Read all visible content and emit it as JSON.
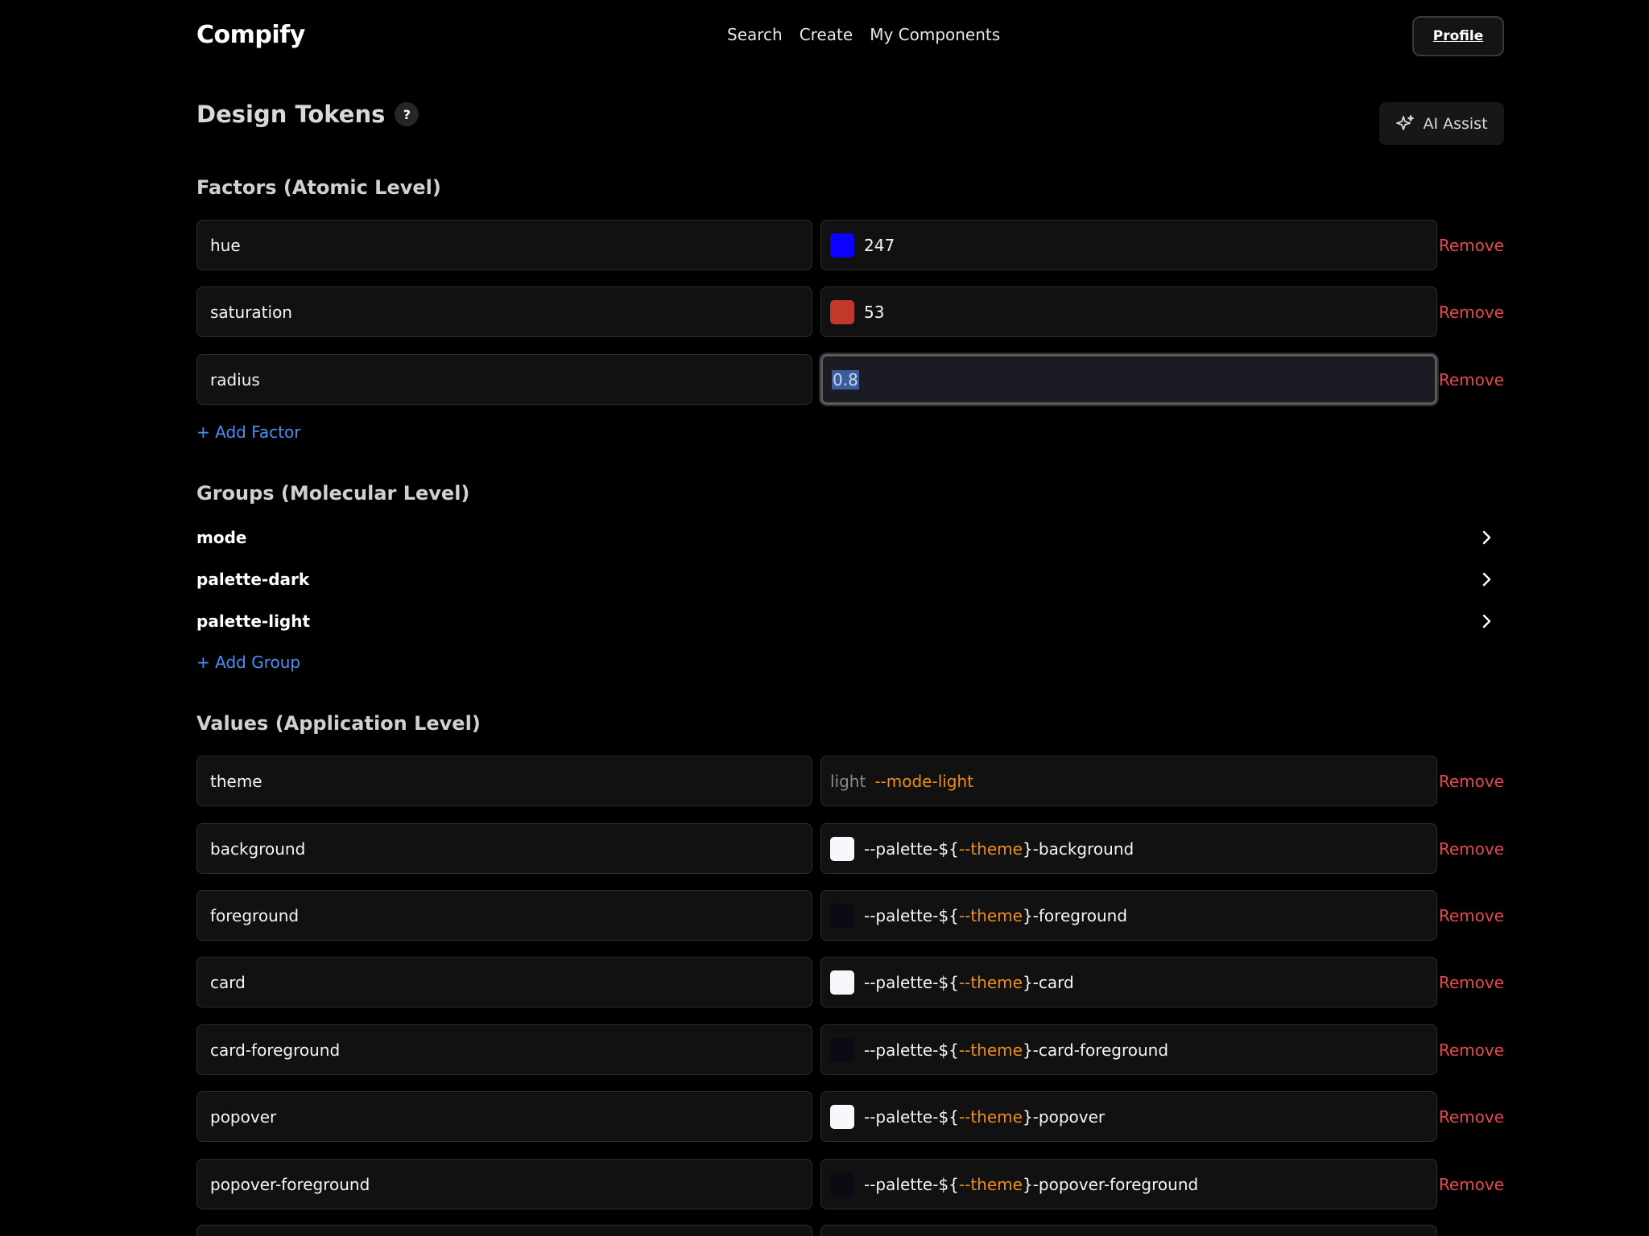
{
  "header": {
    "logo": "Compify",
    "nav": [
      "Search",
      "Create",
      "My Components"
    ],
    "profile_label": "Profile"
  },
  "page": {
    "title": "Design Tokens",
    "help": "?",
    "ai_assist_label": "AI Assist"
  },
  "factors": {
    "title": "Factors (Atomic Level)",
    "add_label": "+ Add Factor",
    "remove_label": "Remove",
    "items": [
      {
        "name": "hue",
        "value": "247",
        "swatch": "#0c00ff"
      },
      {
        "name": "saturation",
        "value": "53",
        "swatch": "#c0392b"
      },
      {
        "name": "radius",
        "value": "0.8"
      }
    ]
  },
  "groups": {
    "title": "Groups (Molecular Level)",
    "add_label": "+ Add Group",
    "items": [
      "mode",
      "palette-dark",
      "palette-light"
    ]
  },
  "values": {
    "title": "Values (Application Level)",
    "remove_label": "Remove",
    "theme": {
      "name": "theme",
      "prefix": "light",
      "ref": "--mode-light"
    },
    "items": [
      {
        "name": "background",
        "pre": "--palette-${",
        "var": "--theme",
        "post": "}-background",
        "swatch": "#f8f8fc"
      },
      {
        "name": "foreground",
        "pre": "--palette-${",
        "var": "--theme",
        "post": "}-foreground",
        "swatch": "#0b0b14"
      },
      {
        "name": "card",
        "pre": "--palette-${",
        "var": "--theme",
        "post": "}-card",
        "swatch": "#f8f8fc"
      },
      {
        "name": "card-foreground",
        "pre": "--palette-${",
        "var": "--theme",
        "post": "}-card-foreground",
        "swatch": "#0b0b14"
      },
      {
        "name": "popover",
        "pre": "--palette-${",
        "var": "--theme",
        "post": "}-popover",
        "swatch": "#f8f8fc"
      },
      {
        "name": "popover-foreground",
        "pre": "--palette-${",
        "var": "--theme",
        "post": "}-popover-foreground",
        "swatch": "#0b0b14"
      }
    ]
  }
}
